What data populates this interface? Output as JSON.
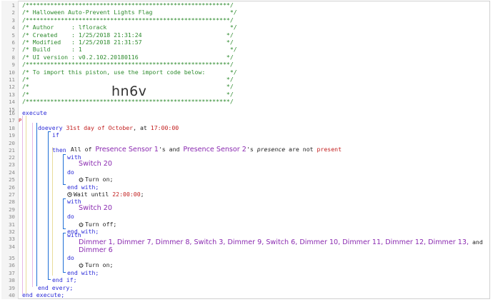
{
  "line_numbers": [
    "1",
    "2",
    "3",
    "4",
    "5",
    "6",
    "7",
    "8",
    "9",
    "10",
    "11",
    "12",
    "13",
    "14",
    "15",
    "16",
    "17",
    "18",
    "19",
    "20",
    "21",
    "22",
    "23",
    "24",
    "25",
    "26",
    "27",
    "28",
    "29",
    "30",
    "31",
    "32",
    "33",
    "34",
    "35",
    "36",
    "37",
    "38",
    "39",
    "40"
  ],
  "header": {
    "border": "/**********************************************************/",
    "title": "/* Halloween Auto-Prevent Lights Flag                      */",
    "sep": "/**********************************************************/",
    "author": "/* Author     : lflorack                                   */",
    "created": "/* Created    : 1/25/2018 21:31:24                        */",
    "modified": "/* Modified   : 1/25/2018 21:31:57                        */",
    "build": "/* Build      : 1                                          */",
    "ui_version": "/* UI version : v0.2.102.20180116                         */",
    "sep2": "/**********************************************************/",
    "import_note": "/* To import this piston, use the import code below:       */",
    "blank1": "/*                                                        */",
    "blank2": "/*                                                        */",
    "blank3": "/*                                                        */",
    "end": "/**********************************************************/"
  },
  "watermark": "hn6v",
  "p_marker": "P",
  "code": {
    "execute": "execute",
    "every_kw": "every",
    "every_day": " 31st day of October",
    "every_at": ", at ",
    "every_time": "17:00:00",
    "do": "do",
    "if": "if",
    "cond_prefix": "All of ",
    "sensor1": "Presence Sensor 1",
    "cond_mid": "'s and ",
    "sensor2": "Presence Sensor 2",
    "cond_poss": "'s ",
    "cond_attr": "presence",
    "cond_are": " are not ",
    "cond_value": "present",
    "then": "then",
    "with": "with",
    "switch20": "Switch 20",
    "turn_on": "Turn on;",
    "end_with": "end with;",
    "wait": "Wait until ",
    "wait_time": "22:00:00",
    "wait_end": ";",
    "turn_off": "Turn off;",
    "devices_list": "Dimmer 1, Dimmer 7, Dimmer 8, Switch 3, Dimmer 9, Switch 6, Dimmer 10, Dimmer 11, Dimmer 12, Dimmer 13,",
    "and": " and",
    "dimmer6": "Dimmer 6",
    "end_if": "end if;",
    "end_every": "end every;",
    "end_execute": "end execute;"
  }
}
